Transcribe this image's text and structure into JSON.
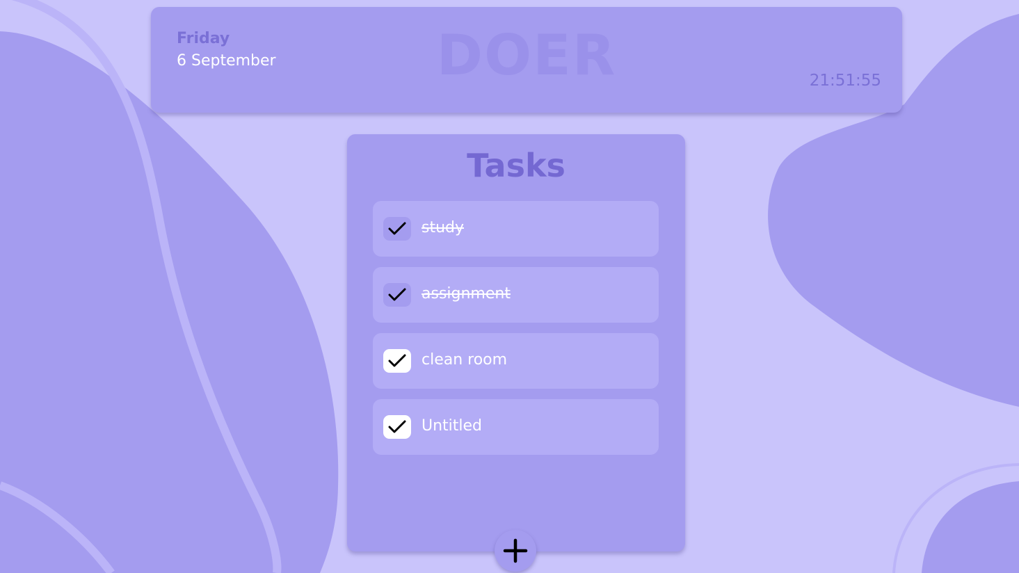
{
  "header": {
    "day": "Friday",
    "date": "6 September",
    "brand": "DOER",
    "time": "21:51:55"
  },
  "tasks": {
    "title": "Tasks",
    "items": [
      {
        "label": "study",
        "done": true
      },
      {
        "label": "assignment",
        "done": true
      },
      {
        "label": "clean room",
        "done": false
      },
      {
        "label": "Untitled",
        "done": false
      }
    ]
  },
  "add_button": {
    "icon": "plus-icon"
  },
  "colors": {
    "background": "#c9c4fb",
    "blob": "#a49cef",
    "card": "#a49cef",
    "task_row": "#b3acf6",
    "accent_text": "#7a70d6",
    "title_text": "#7468d2"
  }
}
